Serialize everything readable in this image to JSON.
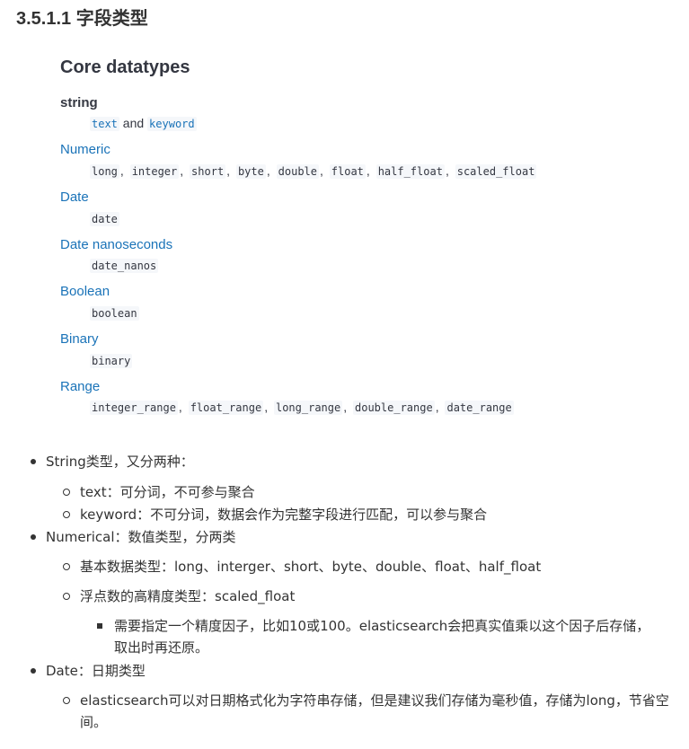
{
  "section_heading": "3.5.1.1 字段类型",
  "core": {
    "title": "Core datatypes",
    "items": [
      {
        "term": "string",
        "codes": [
          "text",
          "keyword"
        ],
        "joiner": "and"
      },
      {
        "term": "Numeric",
        "codes": [
          "long",
          "integer",
          "short",
          "byte",
          "double",
          "float",
          "half_float",
          "scaled_float"
        ]
      },
      {
        "term": "Date",
        "codes": [
          "date"
        ]
      },
      {
        "term": "Date nanoseconds",
        "codes": [
          "date_nanos"
        ]
      },
      {
        "term": "Boolean",
        "codes": [
          "boolean"
        ]
      },
      {
        "term": "Binary",
        "codes": [
          "binary"
        ]
      },
      {
        "term": "Range",
        "codes": [
          "integer_range",
          "float_range",
          "long_range",
          "double_range",
          "date_range"
        ]
      }
    ]
  },
  "notes": {
    "string_type": "String类型，又分两种：",
    "string_text": "text：可分词，不可参与聚合",
    "string_keyword": "keyword：不可分词，数据会作为完整字段进行匹配，可以参与聚合",
    "numerical": "Numerical：数值类型，分两类",
    "num_basic": "基本数据类型：long、interger、short、byte、double、float、half_float",
    "num_float": "浮点数的高精度类型：scaled_float",
    "num_float_note": "需要指定一个精度因子，比如10或100。elasticsearch会把真实值乘以这个因子后存储，取出时再还原。",
    "date": "Date：日期类型",
    "date_note": "elasticsearch可以对日期格式化为字符串存储，但是建议我们存储为毫秒值，存储为long，节省空间。"
  },
  "colors": {
    "link": "#1a73b8",
    "text": "#333333",
    "code_bg": "#f5f7fa"
  }
}
